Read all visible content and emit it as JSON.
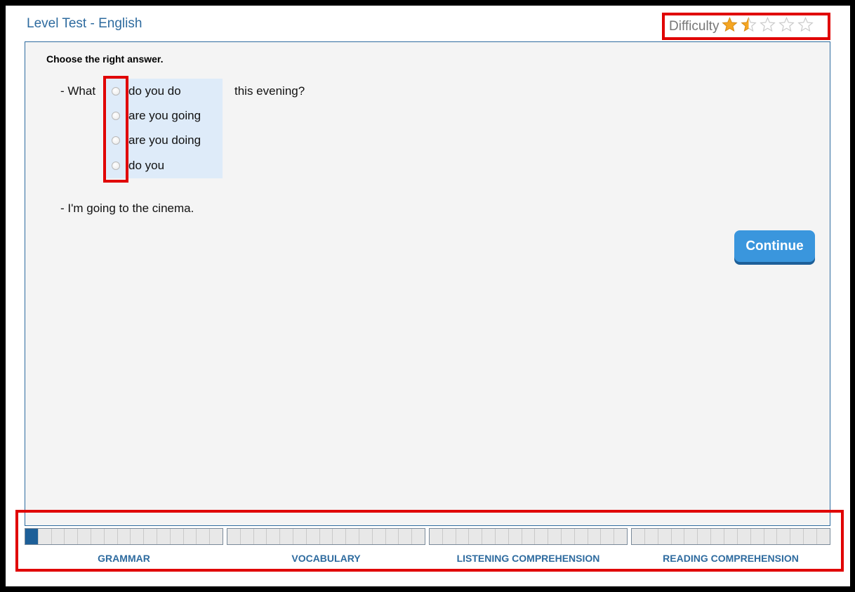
{
  "header": {
    "title": "Level Test - English",
    "difficulty_label": "Difficulty",
    "difficulty_rating": 1.5,
    "difficulty_max": 5,
    "star_color": "#f5a623"
  },
  "question": {
    "instruction": "Choose the right answer.",
    "prefix": "- What",
    "suffix": "this evening?",
    "options": [
      "do you do",
      "are you going",
      "are you doing",
      "do you"
    ],
    "answer_line": "- I'm going to the cinema."
  },
  "actions": {
    "continue_label": "Continue"
  },
  "progress": {
    "sections": [
      {
        "label": "GRAMMAR",
        "filled": 1,
        "total": 15
      },
      {
        "label": "VOCABULARY",
        "filled": 0,
        "total": 15
      },
      {
        "label": "LISTENING COMPREHENSION",
        "filled": 0,
        "total": 15
      },
      {
        "label": "READING COMPREHENSION",
        "filled": 0,
        "total": 15
      }
    ]
  },
  "colors": {
    "accent": "#2e6b9f",
    "button": "#3a96dd",
    "highlight": "#e00000"
  }
}
